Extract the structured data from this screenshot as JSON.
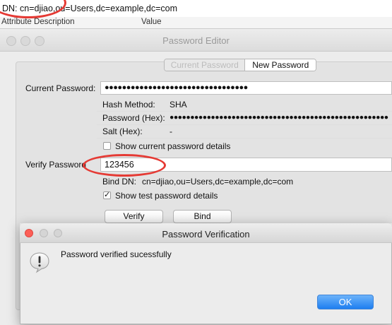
{
  "dn_bar": {
    "text": "DN: cn=djiao,ou=Users,dc=example,dc=com"
  },
  "attribute_table": {
    "columns": [
      "Attribute Description",
      "Value"
    ]
  },
  "editor": {
    "title": "Password Editor",
    "tabs": [
      "Current Password",
      "New Password"
    ],
    "current_password_label": "Current Password:",
    "current_password_value": "●●●●●●●●●●●●●●●●●●●●●●●●●●●●●●●●●",
    "details": [
      {
        "label": "Hash Method:",
        "value": "SHA"
      },
      {
        "label": "Password (Hex):",
        "value": "●●●●●●●●●●●●●●●●●●●●●●●●●●●●●●●●●●●●●●●●●●●●●●●●●●●●●"
      },
      {
        "label": "Salt (Hex):",
        "value": "-"
      }
    ],
    "show_current_details_label": "Show current password details",
    "verify_password_label": "Verify Password",
    "verify_password_value": "123456",
    "bind_dn_label": "Bind DN:",
    "bind_dn_value": "cn=djiao,ou=Users,dc=example,dc=com",
    "show_test_details_label": "Show test password details",
    "verify_button": "Verify",
    "bind_button": "Bind"
  },
  "dialog": {
    "title": "Password Verification",
    "message": "Password verified sucessfully",
    "ok_button": "OK"
  },
  "colors": {
    "accent": "#1e7ef0",
    "annotation": "#e53a34"
  }
}
